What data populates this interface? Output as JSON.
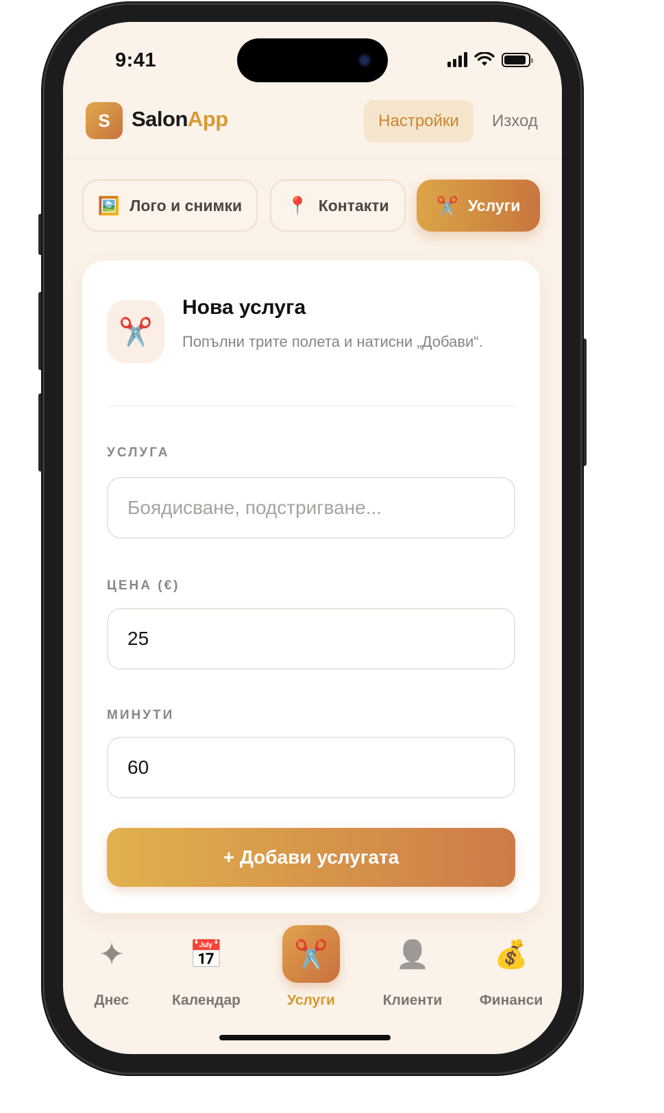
{
  "status": {
    "time": "9:41",
    "battery_level": 0.9
  },
  "header": {
    "logo_letter": "S",
    "brand_part1": "Salon",
    "brand_part2": "App",
    "settings_label": "Настройки",
    "logout_label": "Изход",
    "brand_color": "#d89a35"
  },
  "tabs": [
    {
      "icon": "🖼️",
      "icon_name": "picture-icon",
      "label": "Лого и снимки",
      "active": false
    },
    {
      "icon": "📍",
      "icon_name": "pin-icon",
      "label": "Контакти",
      "active": false
    },
    {
      "icon": "✂️",
      "icon_name": "scissors-icon",
      "label": "Услуги",
      "active": true
    }
  ],
  "card": {
    "icon": "✂️",
    "title": "Нова услуга",
    "subtitle": "Попълни трите полета и натисни „Добави“.",
    "fields": {
      "service": {
        "label": "УСЛУГА",
        "value": "",
        "placeholder": "Боядисване, подстригване..."
      },
      "price": {
        "label": "ЦЕНА (€)",
        "value": "25"
      },
      "minutes": {
        "label": "МИНУТИ",
        "value": "60"
      }
    },
    "add_button": "+ Добави услугата"
  },
  "nav": [
    {
      "icon": "✦",
      "icon_name": "sparkle-icon",
      "label": "Днес",
      "active": false
    },
    {
      "icon": "📅",
      "icon_name": "calendar-icon",
      "label": "Календар",
      "active": false
    },
    {
      "icon": "✂️",
      "icon_name": "scissors-icon",
      "label": "Услуги",
      "active": true
    },
    {
      "icon": "👤",
      "icon_name": "person-icon",
      "label": "Клиенти",
      "active": false
    },
    {
      "icon": "💰",
      "icon_name": "money-bag-icon",
      "label": "Финанси",
      "active": false
    }
  ]
}
